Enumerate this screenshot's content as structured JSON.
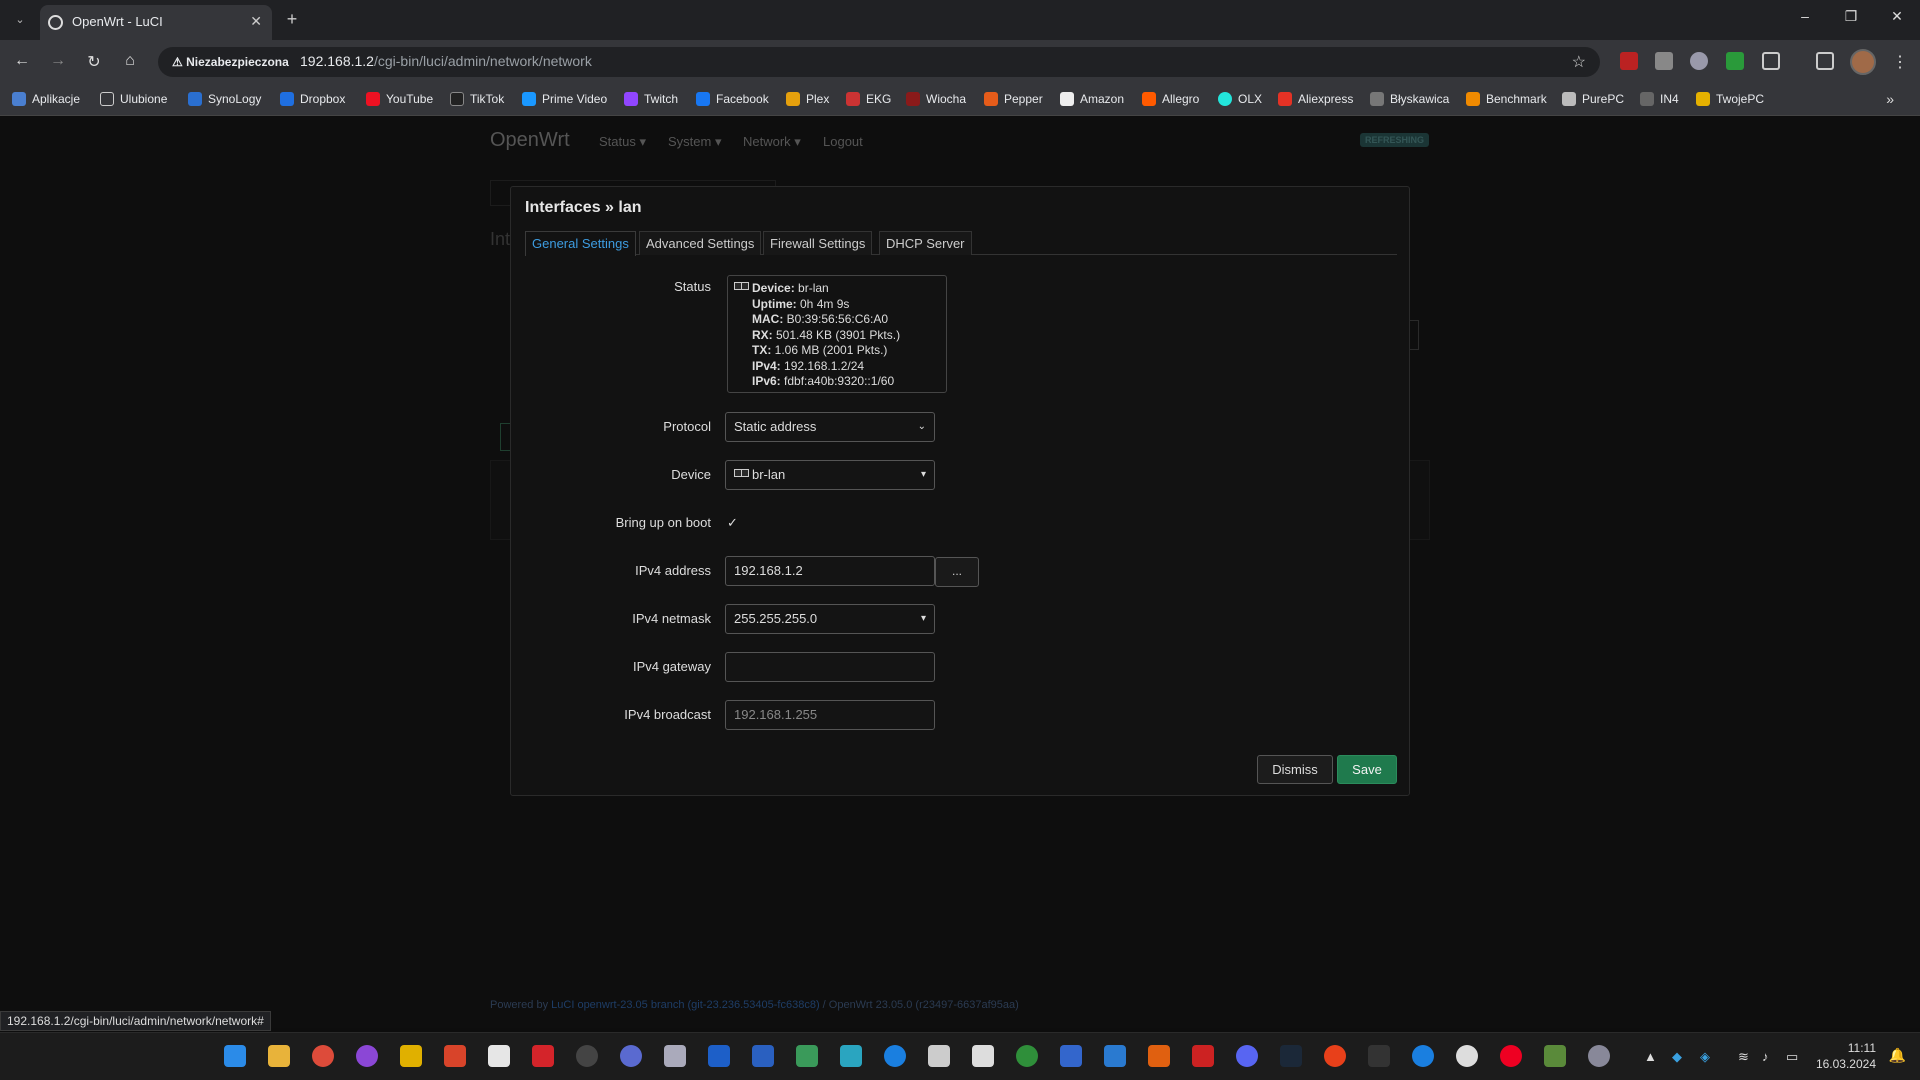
{
  "browser": {
    "tab_title": "OpenWrt - LuCI",
    "security_label": "Niezabezpieczona",
    "url_host": "192.168.1.2",
    "url_path": "/cgi-bin/luci/admin/network/network",
    "bookmarks": [
      "Aplikacje",
      "Ulubione",
      "SynoLogy",
      "Dropbox",
      "YouTube",
      "TikTok",
      "Prime Video",
      "Twitch",
      "Facebook",
      "Plex",
      "EKG",
      "Wiocha",
      "Pepper",
      "Amazon",
      "Allegro",
      "OLX",
      "Aliexpress",
      "Błyskawica",
      "Benchmark",
      "PurePC",
      "IN4",
      "TwojePC"
    ],
    "status_link": "192.168.1.2/cgi-bin/luci/admin/network/network#"
  },
  "page": {
    "brand": "OpenWrt",
    "menu": [
      "Status",
      "System",
      "Network",
      "Logout"
    ],
    "refreshing": "REFRESHING",
    "bg_heading": "Int",
    "footer_prefix": "Powered by ",
    "footer_link": "LuCI openwrt-23.05 branch (git-23.236.53405-fc638c8)",
    "footer_suffix": " / OpenWrt 23.05.0 (r23497-6637af95aa)"
  },
  "modal": {
    "title": "Interfaces » lan",
    "tabs": [
      "General Settings",
      "Advanced Settings",
      "Firewall Settings",
      "DHCP Server"
    ],
    "status_label": "Status",
    "status": {
      "device_key": "Device:",
      "device_val": " br-lan",
      "uptime_key": "Uptime:",
      "uptime_val": " 0h 4m 9s",
      "mac_key": "MAC:",
      "mac_val": " B0:39:56:56:C6:A0",
      "rx_key": "RX:",
      "rx_val": " 501.48 KB (3901 Pkts.)",
      "tx_key": "TX:",
      "tx_val": " 1.06 MB (2001 Pkts.)",
      "ipv4_key": "IPv4:",
      "ipv4_val": " 192.168.1.2/24",
      "ipv6_key": "IPv6:",
      "ipv6_val": " fdbf:a40b:9320::1/60"
    },
    "protocol_label": "Protocol",
    "protocol_value": "Static address",
    "device_label": "Device",
    "device_value": "br-lan",
    "boot_label": "Bring up on boot",
    "boot_checked": true,
    "ipv4_address_label": "IPv4 address",
    "ipv4_address_value": "192.168.1.2",
    "more_button": "...",
    "ipv4_netmask_label": "IPv4 netmask",
    "ipv4_netmask_value": "255.255.255.0",
    "ipv4_gateway_label": "IPv4 gateway",
    "ipv4_gateway_value": "",
    "ipv4_broadcast_label": "IPv4 broadcast",
    "ipv4_broadcast_placeholder": "192.168.1.255",
    "dismiss": "Dismiss",
    "save": "Save"
  },
  "taskbar": {
    "time": "11:11",
    "date": "16.03.2024"
  },
  "colors": {
    "accent": "#3d9ce0",
    "save": "#1f7a4d"
  }
}
